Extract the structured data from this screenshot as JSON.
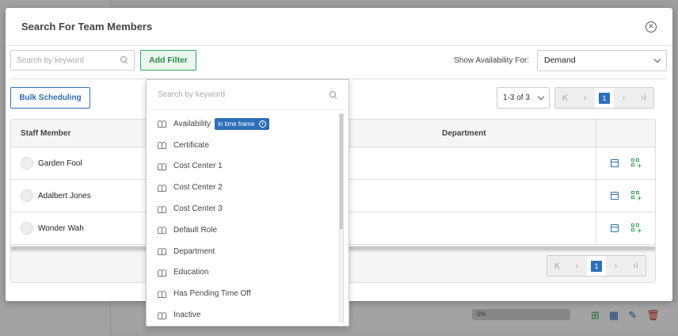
{
  "modal": {
    "title": "Search For Team Members",
    "close_icon": "close-circle-icon"
  },
  "toolbar": {
    "search_placeholder": "Search by keyword",
    "add_filter_label": "Add Filter",
    "availability_label": "Show Availability For:",
    "availability_value": "Demand"
  },
  "bulk_scheduling_label": "Bulk Scheduling",
  "pagination": {
    "count": "1-3 of 3",
    "current_page": "1",
    "first": "K",
    "prev": "‹",
    "next": "›",
    "last": "›I"
  },
  "table": {
    "columns": [
      "Staff Member",
      "Department"
    ],
    "rows": [
      {
        "name": "Garden Fool"
      },
      {
        "name": "Adalbert Jones"
      },
      {
        "name": "Wonder Wah"
      }
    ]
  },
  "filter_dropdown": {
    "search_placeholder": "Search by keyword",
    "items": [
      {
        "label": "Availability",
        "badge": "in time frame"
      },
      {
        "label": "Certificate"
      },
      {
        "label": "Cost Center 1"
      },
      {
        "label": "Cost Center 2"
      },
      {
        "label": "Cost Center 3"
      },
      {
        "label": "Default Role"
      },
      {
        "label": "Department"
      },
      {
        "label": "Education"
      },
      {
        "label": "Has Pending Time Off"
      },
      {
        "label": "Inactive"
      }
    ]
  },
  "background": {
    "progress_label": "0%"
  },
  "colors": {
    "primary": "#2d6fb8",
    "success": "#3aa35c"
  }
}
